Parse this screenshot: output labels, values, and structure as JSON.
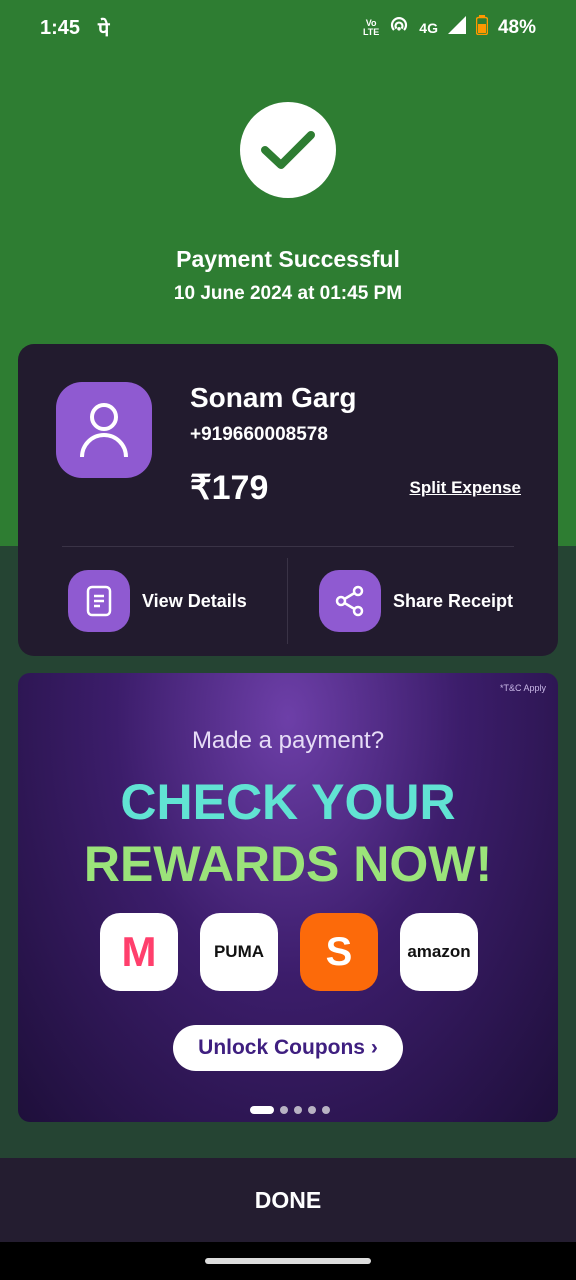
{
  "status_bar": {
    "time": "1:45",
    "app_indicator": "पे",
    "network_type": "4G",
    "volte_label_top": "Vo",
    "volte_label_bottom": "LTE",
    "battery": "48%"
  },
  "payment": {
    "title": "Payment Successful",
    "datetime": "10 June 2024 at 01:45 PM"
  },
  "payee": {
    "name": "Sonam Garg",
    "phone": "+919660008578",
    "amount": "₹179",
    "split_label": "Split Expense"
  },
  "actions": {
    "view_details": "View Details",
    "share_receipt": "Share Receipt"
  },
  "banner": {
    "tc": "*T&C Apply",
    "subtitle": "Made a payment?",
    "headline_line1": "CHECK YOUR",
    "headline_line2": "REWARDS NOW!",
    "brands": [
      "M",
      "PUMA",
      "S",
      "amazon"
    ],
    "cta": "Unlock Coupons ›",
    "active_slide": 1,
    "slide_count": 5
  },
  "footer": {
    "done_label": "DONE"
  },
  "colors": {
    "success_green": "#2e7d32",
    "card_bg": "#221b2e",
    "accent_purple": "#8f5ad1",
    "swiggy_orange": "#fc6a0a"
  }
}
